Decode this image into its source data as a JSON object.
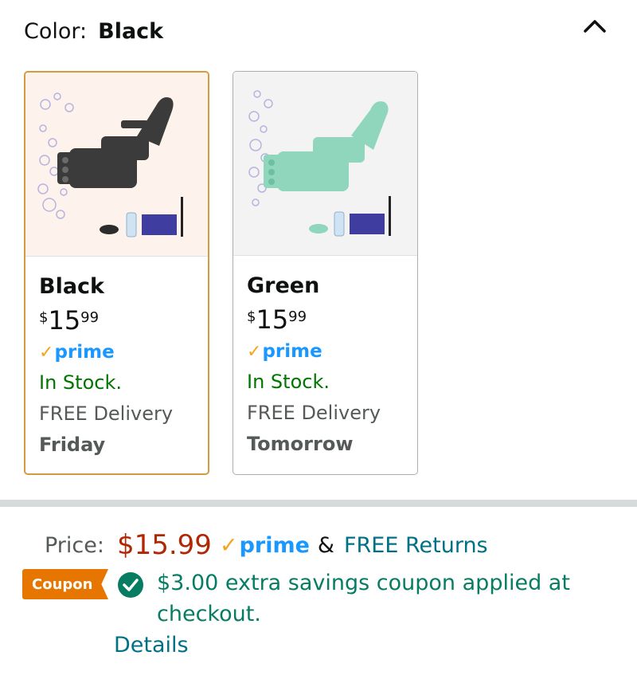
{
  "color_selector": {
    "label": "Color:",
    "selected_value": "Black",
    "collapse_icon": "chevron-up-icon"
  },
  "swatches": [
    {
      "name": "Black",
      "price_symbol": "$",
      "price_whole": "15",
      "price_fraction": "99",
      "prime_label": "prime",
      "stock": "In Stock.",
      "delivery": "FREE Delivery",
      "delivery_day": "Friday",
      "selected": true,
      "product_color": "#3b3b3b"
    },
    {
      "name": "Green",
      "price_symbol": "$",
      "price_whole": "15",
      "price_fraction": "99",
      "prime_label": "prime",
      "stock": "In Stock.",
      "delivery": "FREE Delivery",
      "delivery_day": "Tomorrow",
      "selected": false,
      "product_color": "#8fd6bd"
    }
  ],
  "price_section": {
    "label": "Price:",
    "value": "$15.99",
    "prime_label": "prime",
    "ampersand": "&",
    "returns_link": "FREE Returns"
  },
  "coupon": {
    "badge": "Coupon",
    "text": "$3.00 extra savings coupon applied at checkout.",
    "details_link": "Details"
  },
  "colors": {
    "price_red": "#b12704",
    "stock_green": "#007600",
    "link_teal": "#007185",
    "prime_blue": "#1a98ff",
    "prime_check_orange": "#f7a41d",
    "coupon_orange": "#e77600",
    "coupon_green": "#067d62",
    "selected_border": "#d39c3f"
  }
}
